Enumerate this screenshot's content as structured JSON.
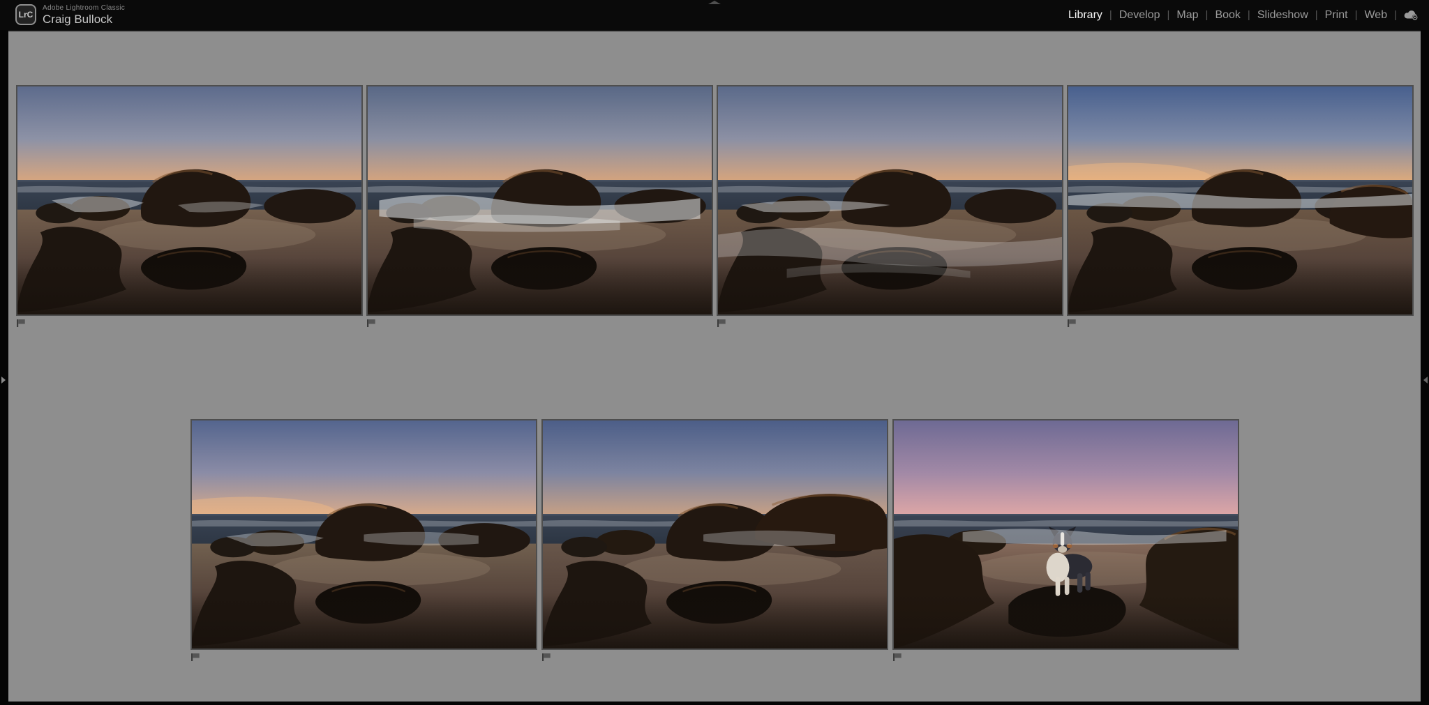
{
  "titlebar": {
    "logo": "LrC",
    "app_name": "Adobe Lightroom Classic",
    "identity_plate": "Craig Bullock"
  },
  "module_picker": {
    "separator": "|",
    "modules": [
      {
        "label": "Library",
        "active": true
      },
      {
        "label": "Develop",
        "active": false
      },
      {
        "label": "Map",
        "active": false
      },
      {
        "label": "Book",
        "active": false
      },
      {
        "label": "Slideshow",
        "active": false
      },
      {
        "label": "Print",
        "active": false
      },
      {
        "label": "Web",
        "active": false
      }
    ],
    "sync_icon": "cloud-sync-icon"
  },
  "panel_toggles": {
    "top": "collapse-top-panel",
    "left": "expand-left-panel",
    "right": "expand-right-panel"
  },
  "colors": {
    "titlebar_bg": "#0a0a0a",
    "workspace_bg": "#8e8e8e",
    "frame_black": "#050505",
    "module_active": "#f8f8f8",
    "module_inactive": "#9b9b9b",
    "photo_border": "#4e4e4e"
  },
  "survey_view": {
    "rows": [
      {
        "photos": [
          {
            "id": 1,
            "variant": 1,
            "description": "Long exposure seascape, mist drifting over rocks at dusk",
            "sky_top": "#5d6b8c",
            "sky_mid": "#8d92a6",
            "sky_horizon": "#d9a67e",
            "sea": "#2c3542",
            "sand": "#75604e",
            "glow": false,
            "dog": false,
            "flag_badge": true
          },
          {
            "id": 2,
            "variant": 2,
            "description": "Long exposure seascape, white wash surging through rocks",
            "sky_top": "#596886",
            "sky_mid": "#8a8fa2",
            "sky_horizon": "#d6a47d",
            "sea": "#2b3440",
            "sand": "#6f5a49",
            "glow": false,
            "dog": false,
            "flag_badge": true
          },
          {
            "id": 3,
            "variant": 3,
            "description": "Long exposure seascape, water sweeping across the sand",
            "sky_top": "#5b6a8a",
            "sky_mid": "#8c90a4",
            "sky_horizon": "#d8a57c",
            "sea": "#2c3441",
            "sand": "#6d5846",
            "glow": false,
            "dog": false,
            "flag_badge": true
          },
          {
            "id": 4,
            "variant": 4,
            "description": "Long exposure seascape, round boulder under sunset glow",
            "sky_top": "#48608e",
            "sky_mid": "#7e8aa6",
            "sky_horizon": "#e0ab7b",
            "sea": "#27303d",
            "sand": "#6b5644",
            "glow": true,
            "dog": false,
            "flag_badge": true
          }
        ]
      },
      {
        "photos": [
          {
            "id": 5,
            "variant": 5,
            "description": "Long exposure seascape, dusk glow low on the horizon",
            "sky_top": "#54658e",
            "sky_mid": "#8b8ca6",
            "sky_horizon": "#d9ab8a",
            "sea": "#2b3441",
            "sand": "#71604f",
            "glow": true,
            "dog": false,
            "flag_badge": true
          },
          {
            "id": 6,
            "variant": 6,
            "description": "Long exposure seascape, large rock shelf on the right",
            "sky_top": "#4c5e88",
            "sky_mid": "#7d84a0",
            "sky_horizon": "#c9a184",
            "sea": "#29323f",
            "sand": "#68564a",
            "glow": false,
            "dog": false,
            "flag_badge": true
          },
          {
            "id": 7,
            "variant": 7,
            "description": "Australian Shepherd dog standing on a rock at pink dusk",
            "sky_top": "#6e6a94",
            "sky_mid": "#a289a6",
            "sky_horizon": "#dfa7a6",
            "sea": "#2e3542",
            "sand": "#84695a",
            "glow": false,
            "dog": true,
            "flag_badge": true
          }
        ]
      }
    ]
  }
}
